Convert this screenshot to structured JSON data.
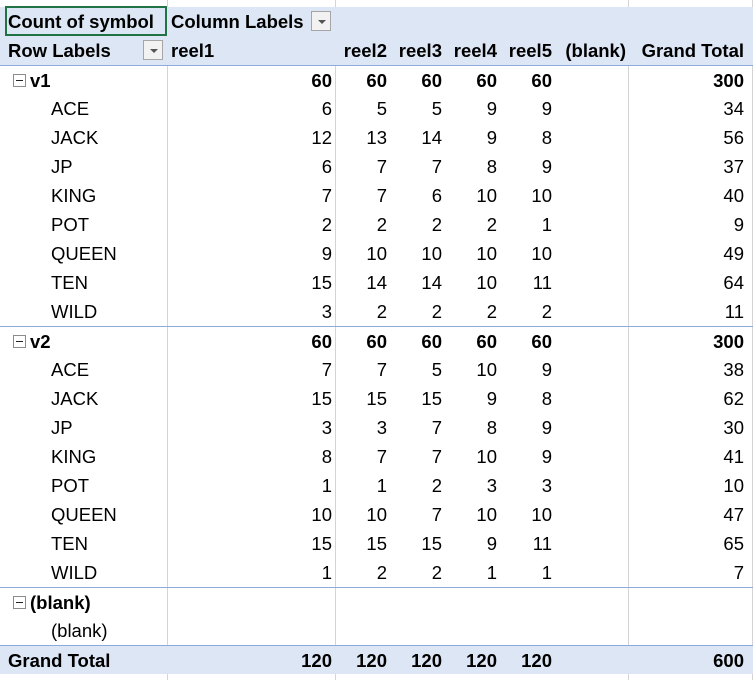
{
  "pivot": {
    "value_field": "Count of symbol",
    "column_labels": "Column Labels",
    "row_labels": "Row Labels",
    "columns": [
      "reel1",
      "reel2",
      "reel3",
      "reel4",
      "reel5",
      "(blank)",
      "Grand Total"
    ],
    "groups": [
      {
        "name": "v1",
        "totals": [
          "60",
          "60",
          "60",
          "60",
          "60",
          "",
          "300"
        ],
        "items": [
          {
            "label": "ACE",
            "values": [
              "6",
              "5",
              "5",
              "9",
              "9",
              "",
              "34"
            ]
          },
          {
            "label": "JACK",
            "values": [
              "12",
              "13",
              "14",
              "9",
              "8",
              "",
              "56"
            ]
          },
          {
            "label": "JP",
            "values": [
              "6",
              "7",
              "7",
              "8",
              "9",
              "",
              "37"
            ]
          },
          {
            "label": "KING",
            "values": [
              "7",
              "7",
              "6",
              "10",
              "10",
              "",
              "40"
            ]
          },
          {
            "label": "POT",
            "values": [
              "2",
              "2",
              "2",
              "2",
              "1",
              "",
              "9"
            ]
          },
          {
            "label": "QUEEN",
            "values": [
              "9",
              "10",
              "10",
              "10",
              "10",
              "",
              "49"
            ]
          },
          {
            "label": "TEN",
            "values": [
              "15",
              "14",
              "14",
              "10",
              "11",
              "",
              "64"
            ]
          },
          {
            "label": "WILD",
            "values": [
              "3",
              "2",
              "2",
              "2",
              "2",
              "",
              "11"
            ]
          }
        ]
      },
      {
        "name": "v2",
        "totals": [
          "60",
          "60",
          "60",
          "60",
          "60",
          "",
          "300"
        ],
        "items": [
          {
            "label": "ACE",
            "values": [
              "7",
              "7",
              "5",
              "10",
              "9",
              "",
              "38"
            ]
          },
          {
            "label": "JACK",
            "values": [
              "15",
              "15",
              "15",
              "9",
              "8",
              "",
              "62"
            ]
          },
          {
            "label": "JP",
            "values": [
              "3",
              "3",
              "7",
              "8",
              "9",
              "",
              "30"
            ]
          },
          {
            "label": "KING",
            "values": [
              "8",
              "7",
              "7",
              "10",
              "9",
              "",
              "41"
            ]
          },
          {
            "label": "POT",
            "values": [
              "1",
              "1",
              "2",
              "3",
              "3",
              "",
              "10"
            ]
          },
          {
            "label": "QUEEN",
            "values": [
              "10",
              "10",
              "7",
              "10",
              "10",
              "",
              "47"
            ]
          },
          {
            "label": "TEN",
            "values": [
              "15",
              "15",
              "15",
              "9",
              "11",
              "",
              "65"
            ]
          },
          {
            "label": "WILD",
            "values": [
              "1",
              "2",
              "2",
              "1",
              "1",
              "",
              "7"
            ]
          }
        ]
      },
      {
        "name": "(blank)",
        "totals": [
          "",
          "",
          "",
          "",
          "",
          "",
          ""
        ],
        "items": [
          {
            "label": "(blank)",
            "values": [
              "",
              "",
              "",
              "",
              "",
              "",
              ""
            ]
          }
        ]
      }
    ],
    "grand_total": {
      "label": "Grand Total",
      "values": [
        "120",
        "120",
        "120",
        "120",
        "120",
        "",
        "600"
      ]
    }
  }
}
